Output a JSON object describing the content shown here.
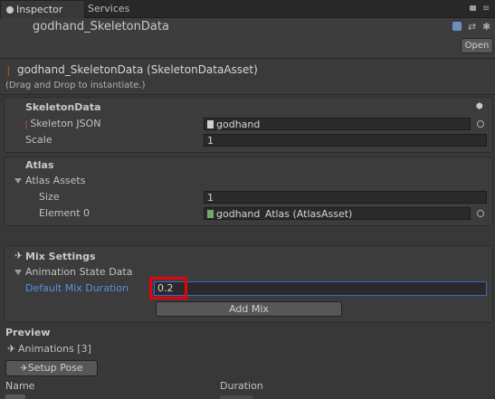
{
  "tabs": [
    {
      "label": "Inspector",
      "icon": "info-icon"
    },
    {
      "label": "Services"
    }
  ],
  "header": {
    "asset_name": "godhand_SkeletonData",
    "open_label": "Open"
  },
  "main_title": "godhand_SkeletonData (SkeletonDataAsset)",
  "hint": "(Drag and Drop to instantiate.)",
  "skeleton_data": {
    "heading": "SkeletonData",
    "json_label": "Skeleton JSON",
    "json_value": "godhand",
    "scale_label": "Scale",
    "scale_value": "1"
  },
  "atlas": {
    "heading": "Atlas",
    "assets_label": "Atlas Assets",
    "size_label": "Size",
    "size_value": "1",
    "element_label": "Element 0",
    "element_value": "godhand_Atlas (AtlasAsset)"
  },
  "mix": {
    "heading": "Mix Settings",
    "state_label": "Animation State Data",
    "duration_label": "Default Mix Duration",
    "duration_value": "0.2",
    "add_mix_label": "Add Mix"
  },
  "preview": {
    "heading": "Preview",
    "animations_label": "Animations [3]",
    "setup_pose_label": "Setup Pose",
    "col_name": "Name",
    "col_duration": "Duration"
  },
  "colors": {
    "highlight": "#e8000b",
    "link_label": "#5b8fe3",
    "active_field_border": "#3c66c2"
  }
}
